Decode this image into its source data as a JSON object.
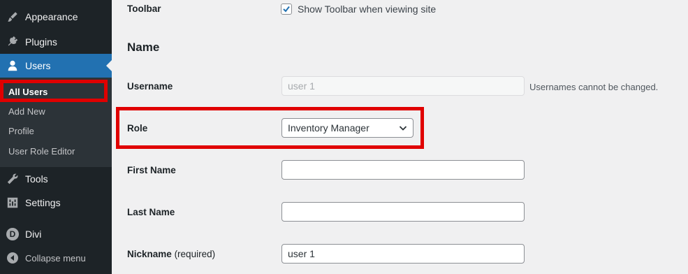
{
  "sidebar": {
    "items": [
      {
        "label": "Appearance",
        "icon": "paintbrush-icon"
      },
      {
        "label": "Plugins",
        "icon": "plugin-icon"
      },
      {
        "label": "Users",
        "icon": "user-icon"
      },
      {
        "label": "Tools",
        "icon": "wrench-icon"
      },
      {
        "label": "Settings",
        "icon": "settings-icon"
      },
      {
        "label": "Divi",
        "icon": "divi-icon",
        "logo_letter": "D"
      },
      {
        "label": "Collapse menu",
        "icon": "collapse-icon"
      }
    ],
    "submenu": [
      "All Users",
      "Add New",
      "Profile",
      "User Role Editor"
    ]
  },
  "form": {
    "toolbar_label": "Toolbar",
    "toolbar_checkbox_label": "Show Toolbar when viewing site",
    "toolbar_checked": true,
    "name_heading": "Name",
    "username_label": "Username",
    "username_value": "user 1",
    "username_note": "Usernames cannot be changed.",
    "role_label": "Role",
    "role_value": "Inventory Manager",
    "first_name_label": "First Name",
    "first_name_value": "",
    "last_name_label": "Last Name",
    "last_name_value": "",
    "nickname_label": "Nickname",
    "nickname_required": "(required)",
    "nickname_value": "user 1"
  },
  "colors": {
    "sidebar_bg": "#1d2327",
    "submenu_bg": "#2c3338",
    "accent": "#2271b1",
    "highlight": "#e00000",
    "page_bg": "#f0f0f1"
  }
}
